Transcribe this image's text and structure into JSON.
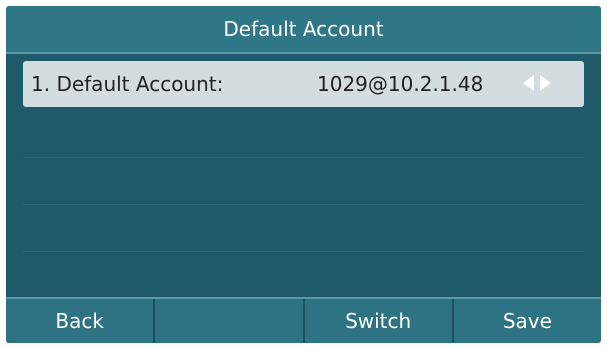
{
  "title": "Default Account",
  "selected_row": {
    "label": "1. Default Account:",
    "value": "1029@10.2.1.48"
  },
  "icons": {
    "left": "left-arrow-icon",
    "right": "right-arrow-icon"
  },
  "softkeys": [
    "Back",
    "",
    "Switch",
    "Save"
  ],
  "colors": {
    "screen_bg": "#1f5a6b",
    "title_bg": "#2f7687",
    "row_highlight": "#d3dcdf",
    "softkey_bg": "#2e7384"
  }
}
